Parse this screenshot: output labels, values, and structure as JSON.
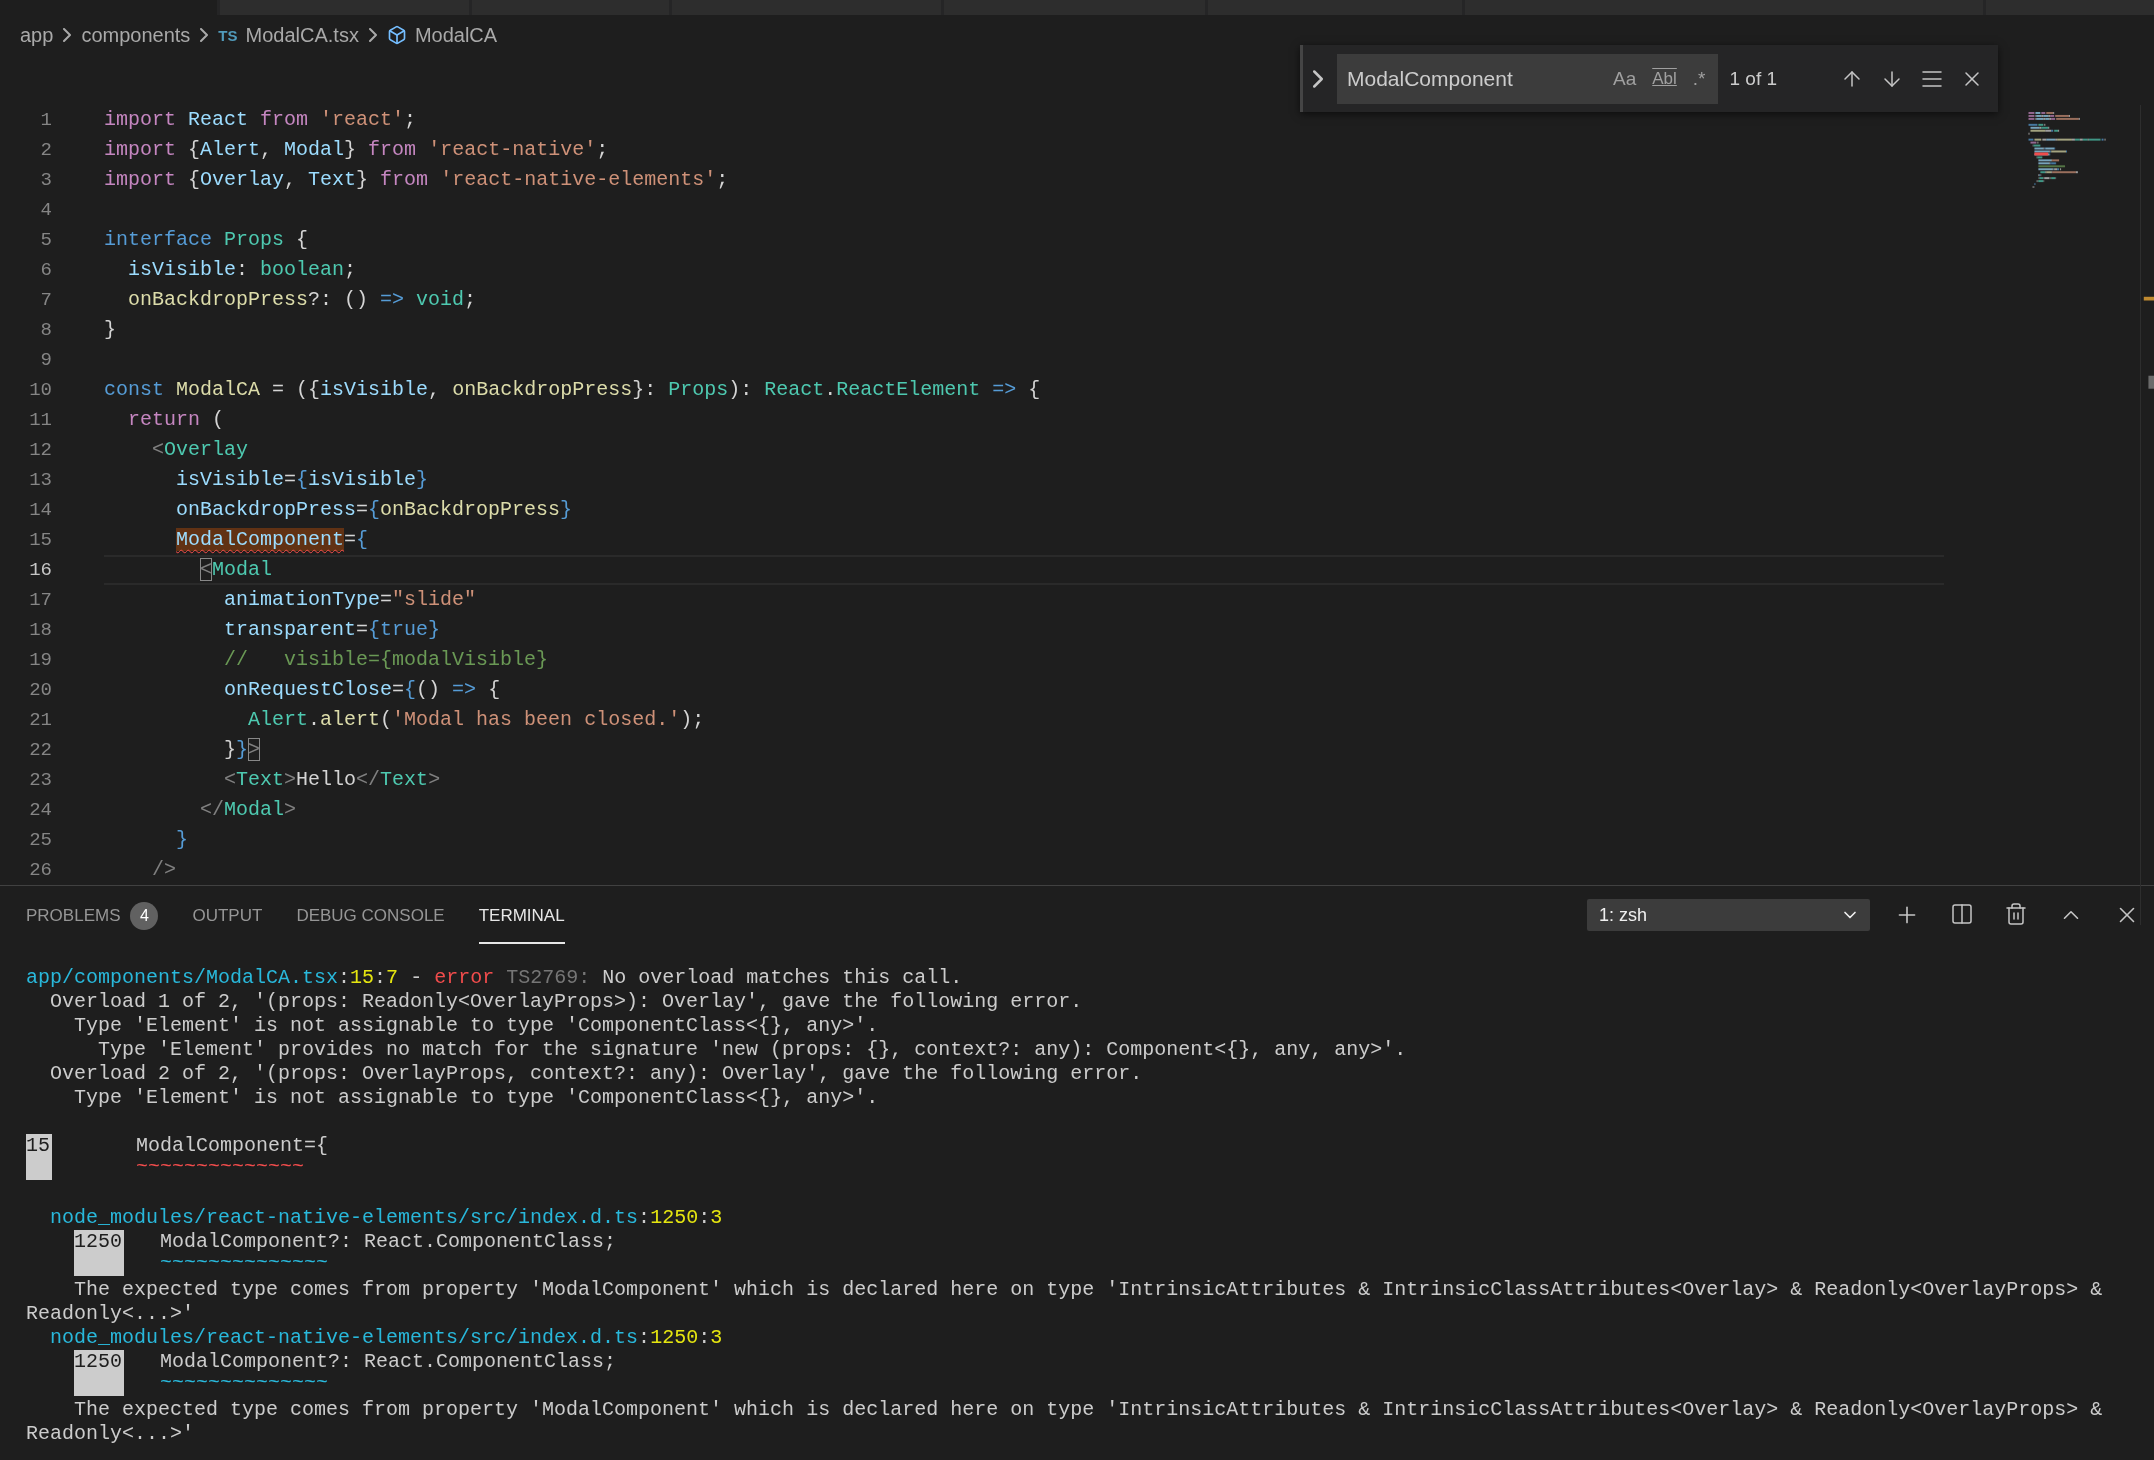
{
  "tab_strip": [
    {
      "selected": true
    },
    {
      "selected": false
    },
    {
      "selected": false
    },
    {
      "selected": false
    },
    {
      "selected": false
    },
    {
      "selected": false
    },
    {
      "selected": false
    },
    {
      "selected": false
    }
  ],
  "breadcrumb": [
    {
      "kind": "folder",
      "label": "app"
    },
    {
      "kind": "folder",
      "label": "components"
    },
    {
      "kind": "file",
      "badge": "TS",
      "label": "ModalCA.tsx"
    },
    {
      "kind": "symbol",
      "label": "ModalCA"
    }
  ],
  "find": {
    "value": "ModalComponent",
    "options": [
      {
        "label": "Aa",
        "on": false
      },
      {
        "label": "Abl",
        "on": false
      },
      {
        "label": ".*",
        "on": false
      }
    ],
    "match_count": "1 of 1"
  },
  "editor": {
    "lines": [
      {
        "number": "1",
        "current": false,
        "tokens": [
          {
            "text": "import",
            "kind": "kw"
          },
          {
            "text": " React",
            "kind": "var"
          },
          {
            "text": " from",
            "kind": "kw"
          },
          {
            "text": " 'react'",
            "kind": "str"
          },
          {
            "text": ";",
            "kind": "p"
          }
        ]
      },
      {
        "number": "2",
        "current": false,
        "tokens": [
          {
            "text": "import",
            "kind": "kw"
          },
          {
            "text": " {",
            "kind": "p"
          },
          {
            "text": "Alert",
            "kind": "var"
          },
          {
            "text": ", ",
            "kind": "p"
          },
          {
            "text": "Modal",
            "kind": "var"
          },
          {
            "text": "} ",
            "kind": "p"
          },
          {
            "text": "from",
            "kind": "kw"
          },
          {
            "text": " 'react-native'",
            "kind": "str"
          },
          {
            "text": ";",
            "kind": "p"
          }
        ]
      },
      {
        "number": "3",
        "current": false,
        "tokens": [
          {
            "text": "import",
            "kind": "kw"
          },
          {
            "text": " {",
            "kind": "p"
          },
          {
            "text": "Overlay",
            "kind": "var"
          },
          {
            "text": ", ",
            "kind": "p"
          },
          {
            "text": "Text",
            "kind": "var"
          },
          {
            "text": "} ",
            "kind": "p"
          },
          {
            "text": "from",
            "kind": "kw"
          },
          {
            "text": " 'react-native-elements'",
            "kind": "str"
          },
          {
            "text": ";",
            "kind": "p"
          }
        ]
      },
      {
        "number": "4",
        "current": false
      },
      {
        "number": "5",
        "current": false,
        "tokens": [
          {
            "text": "interface",
            "kind": "storage"
          },
          {
            "text": " Props",
            "kind": "type"
          },
          {
            "text": " {",
            "kind": "p"
          }
        ]
      },
      {
        "number": "6",
        "current": false,
        "tokens": [
          {
            "text": "  isVisible",
            "kind": "var"
          },
          {
            "text": ": ",
            "kind": "p"
          },
          {
            "text": "boolean",
            "kind": "type"
          },
          {
            "text": ";",
            "kind": "p"
          }
        ]
      },
      {
        "number": "7",
        "current": false,
        "tokens": [
          {
            "text": "  onBackdropPress",
            "kind": "fn"
          },
          {
            "text": "?: () ",
            "kind": "p"
          },
          {
            "text": "=>",
            "kind": "storage"
          },
          {
            "text": " void",
            "kind": "type"
          },
          {
            "text": ";",
            "kind": "p"
          }
        ]
      },
      {
        "number": "8",
        "current": false,
        "tokens": [
          {
            "text": "}",
            "kind": "p"
          }
        ]
      },
      {
        "number": "9",
        "current": false
      },
      {
        "number": "10",
        "current": false,
        "tokens": [
          {
            "text": "const",
            "kind": "storage"
          },
          {
            "text": " ModalCA",
            "kind": "fn"
          },
          {
            "text": " = ({",
            "kind": "p"
          },
          {
            "text": "isVisible",
            "kind": "var"
          },
          {
            "text": ", ",
            "kind": "p"
          },
          {
            "text": "onBackdropPress",
            "kind": "fn"
          },
          {
            "text": "}: ",
            "kind": "p"
          },
          {
            "text": "Props",
            "kind": "type"
          },
          {
            "text": "): ",
            "kind": "p"
          },
          {
            "text": "React",
            "kind": "type"
          },
          {
            "text": ".",
            "kind": "p"
          },
          {
            "text": "ReactElement",
            "kind": "type"
          },
          {
            "text": " =>",
            "kind": "storage"
          },
          {
            "text": " {",
            "kind": "p"
          }
        ]
      },
      {
        "number": "11",
        "current": false,
        "tokens": [
          {
            "text": "  return",
            "kind": "kw"
          },
          {
            "text": " (",
            "kind": "p"
          }
        ]
      },
      {
        "number": "12",
        "current": false,
        "tokens": [
          {
            "text": "    <",
            "kind": "tag"
          },
          {
            "text": "Overlay",
            "kind": "type"
          }
        ]
      },
      {
        "number": "13",
        "current": false,
        "tokens": [
          {
            "text": "      isVisible",
            "kind": "var"
          },
          {
            "text": "=",
            "kind": "p"
          },
          {
            "text": "{",
            "kind": "brace"
          },
          {
            "text": "isVisible",
            "kind": "var"
          },
          {
            "text": "}",
            "kind": "brace"
          }
        ]
      },
      {
        "number": "14",
        "current": false,
        "tokens": [
          {
            "text": "      onBackdropPress",
            "kind": "var"
          },
          {
            "text": "=",
            "kind": "p"
          },
          {
            "text": "{",
            "kind": "brace"
          },
          {
            "text": "onBackdropPress",
            "kind": "fn"
          },
          {
            "text": "}",
            "kind": "brace"
          }
        ]
      },
      {
        "number": "15",
        "current": false,
        "tokens": [
          {
            "text": "      ModalComponent",
            "kind": "var",
            "find_match": true,
            "error": true
          },
          {
            "text": "=",
            "kind": "p"
          },
          {
            "text": "{",
            "kind": "brace"
          }
        ]
      },
      {
        "number": "16",
        "current": true,
        "tokens": [
          {
            "text": "        <",
            "kind": "tag",
            "bracket_match": true
          },
          {
            "text": "Modal",
            "kind": "type"
          }
        ]
      },
      {
        "number": "17",
        "current": false,
        "tokens": [
          {
            "text": "          animationType",
            "kind": "var"
          },
          {
            "text": "=",
            "kind": "p"
          },
          {
            "text": "\"slide\"",
            "kind": "str"
          }
        ]
      },
      {
        "number": "18",
        "current": false,
        "tokens": [
          {
            "text": "          transparent",
            "kind": "var"
          },
          {
            "text": "=",
            "kind": "p"
          },
          {
            "text": "{",
            "kind": "brace"
          },
          {
            "text": "true",
            "kind": "storage"
          },
          {
            "text": "}",
            "kind": "brace"
          }
        ]
      },
      {
        "number": "19",
        "current": false,
        "tokens": [
          {
            "text": "          //   visible={modalVisible}",
            "kind": "comment"
          }
        ]
      },
      {
        "number": "20",
        "current": false,
        "tokens": [
          {
            "text": "          onRequestClose",
            "kind": "var"
          },
          {
            "text": "=",
            "kind": "p"
          },
          {
            "text": "{",
            "kind": "brace"
          },
          {
            "text": "() ",
            "kind": "p"
          },
          {
            "text": "=>",
            "kind": "storage"
          },
          {
            "text": " {",
            "kind": "p"
          }
        ]
      },
      {
        "number": "21",
        "current": false,
        "tokens": [
          {
            "text": "            Alert",
            "kind": "type"
          },
          {
            "text": ".",
            "kind": "p"
          },
          {
            "text": "alert",
            "kind": "fn"
          },
          {
            "text": "(",
            "kind": "p"
          },
          {
            "text": "'Modal has been closed.'",
            "kind": "str"
          },
          {
            "text": ");",
            "kind": "p"
          }
        ]
      },
      {
        "number": "22",
        "current": false,
        "tokens": [
          {
            "text": "          }",
            "kind": "p"
          },
          {
            "text": "}",
            "kind": "brace"
          },
          {
            "text": ">",
            "kind": "tag",
            "bracket_match": true
          }
        ]
      },
      {
        "number": "23",
        "current": false,
        "tokens": [
          {
            "text": "          <",
            "kind": "tag"
          },
          {
            "text": "Text",
            "kind": "type"
          },
          {
            "text": ">",
            "kind": "tag"
          },
          {
            "text": "Hello",
            "kind": "p"
          },
          {
            "text": "</",
            "kind": "tag"
          },
          {
            "text": "Text",
            "kind": "type"
          },
          {
            "text": ">",
            "kind": "tag"
          }
        ]
      },
      {
        "number": "24",
        "current": false,
        "tokens": [
          {
            "text": "        </",
            "kind": "tag"
          },
          {
            "text": "Modal",
            "kind": "type"
          },
          {
            "text": ">",
            "kind": "tag"
          }
        ]
      },
      {
        "number": "25",
        "current": false,
        "tokens": [
          {
            "text": "      }",
            "kind": "brace"
          }
        ]
      },
      {
        "number": "26",
        "current": false,
        "tokens": [
          {
            "text": "    />",
            "kind": "tag"
          }
        ]
      }
    ]
  },
  "panel": {
    "tabs": [
      {
        "label": "PROBLEMS",
        "count": "4",
        "selected": false
      },
      {
        "label": "OUTPUT",
        "selected": false
      },
      {
        "label": "DEBUG CONSOLE",
        "selected": false
      },
      {
        "label": "TERMINAL",
        "selected": true
      }
    ],
    "terminal_select": "1: zsh",
    "terminal": [
      {
        "kind": "text",
        "segments": [
          {
            "text": "app/components/ModalCA.tsx",
            "kind": "path"
          },
          {
            "text": ":",
            "kind": "plain"
          },
          {
            "text": "15",
            "kind": "num"
          },
          {
            "text": ":",
            "kind": "plain"
          },
          {
            "text": "7",
            "kind": "num"
          },
          {
            "text": " - ",
            "kind": "plain"
          },
          {
            "text": "error",
            "kind": "error"
          },
          {
            "text": " TS2769:",
            "kind": "dim"
          },
          {
            "text": " No overload matches this call.",
            "kind": "plain"
          }
        ]
      },
      {
        "kind": "text",
        "segments": [
          {
            "text": "  Overload 1 of 2, '(props: Readonly<OverlayProps>): Overlay', gave the following error.",
            "kind": "plain"
          }
        ]
      },
      {
        "kind": "text",
        "segments": [
          {
            "text": "    Type 'Element' is not assignable to type 'ComponentClass<{}, any>'.",
            "kind": "plain"
          }
        ]
      },
      {
        "kind": "text",
        "segments": [
          {
            "text": "      Type 'Element' provides no match for the signature 'new (props: {}, context?: any): Component<{}, any, any>'.",
            "kind": "plain"
          }
        ]
      },
      {
        "kind": "text",
        "segments": [
          {
            "text": "  Overload 2 of 2, '(props: OverlayProps, context?: any): Overlay', gave the following error.",
            "kind": "plain"
          }
        ]
      },
      {
        "kind": "text",
        "segments": [
          {
            "text": "    Type 'Element' is not assignable to type 'ComponentClass<{}, any>'.",
            "kind": "plain"
          }
        ]
      },
      {
        "kind": "blank"
      },
      {
        "kind": "snippet",
        "nested": false,
        "gutter": "15",
        "code": "      ModalComponent={",
        "squiggle": "      ~~~~~~~~~~~~~~",
        "error": true
      },
      {
        "kind": "blank"
      },
      {
        "kind": "text",
        "segments": [
          {
            "text": "  node_modules/react-native-elements/src/index.d.ts",
            "kind": "path"
          },
          {
            "text": ":",
            "kind": "plain"
          },
          {
            "text": "1250",
            "kind": "num"
          },
          {
            "text": ":",
            "kind": "plain"
          },
          {
            "text": "3",
            "kind": "num"
          }
        ]
      },
      {
        "kind": "snippet",
        "nested": true,
        "gutter": "1250",
        "code": "  ModalComponent?: React.ComponentClass;",
        "squiggle": "  ~~~~~~~~~~~~~~",
        "error": false
      },
      {
        "kind": "text",
        "segments": [
          {
            "text": "    The expected type comes from property 'ModalComponent' which is declared here on type 'IntrinsicAttributes & IntrinsicClassAttributes<Overlay> & Readonly<OverlayProps> &",
            "kind": "plain"
          }
        ]
      },
      {
        "kind": "text",
        "segments": [
          {
            "text": "Readonly<...>'",
            "kind": "plain"
          }
        ]
      },
      {
        "kind": "text",
        "segments": [
          {
            "text": "  node_modules/react-native-elements/src/index.d.ts",
            "kind": "path"
          },
          {
            "text": ":",
            "kind": "plain"
          },
          {
            "text": "1250",
            "kind": "num"
          },
          {
            "text": ":",
            "kind": "plain"
          },
          {
            "text": "3",
            "kind": "num"
          }
        ]
      },
      {
        "kind": "snippet",
        "nested": true,
        "gutter": "1250",
        "code": "  ModalComponent?: React.ComponentClass;",
        "squiggle": "  ~~~~~~~~~~~~~~",
        "error": false
      },
      {
        "kind": "text",
        "segments": [
          {
            "text": "    The expected type comes from property 'ModalComponent' which is declared here on type 'IntrinsicAttributes & IntrinsicClassAttributes<Overlay> & Readonly<OverlayProps> &",
            "kind": "plain"
          }
        ]
      },
      {
        "kind": "text",
        "segments": [
          {
            "text": "Readonly<...>'",
            "kind": "plain"
          }
        ]
      }
    ]
  }
}
